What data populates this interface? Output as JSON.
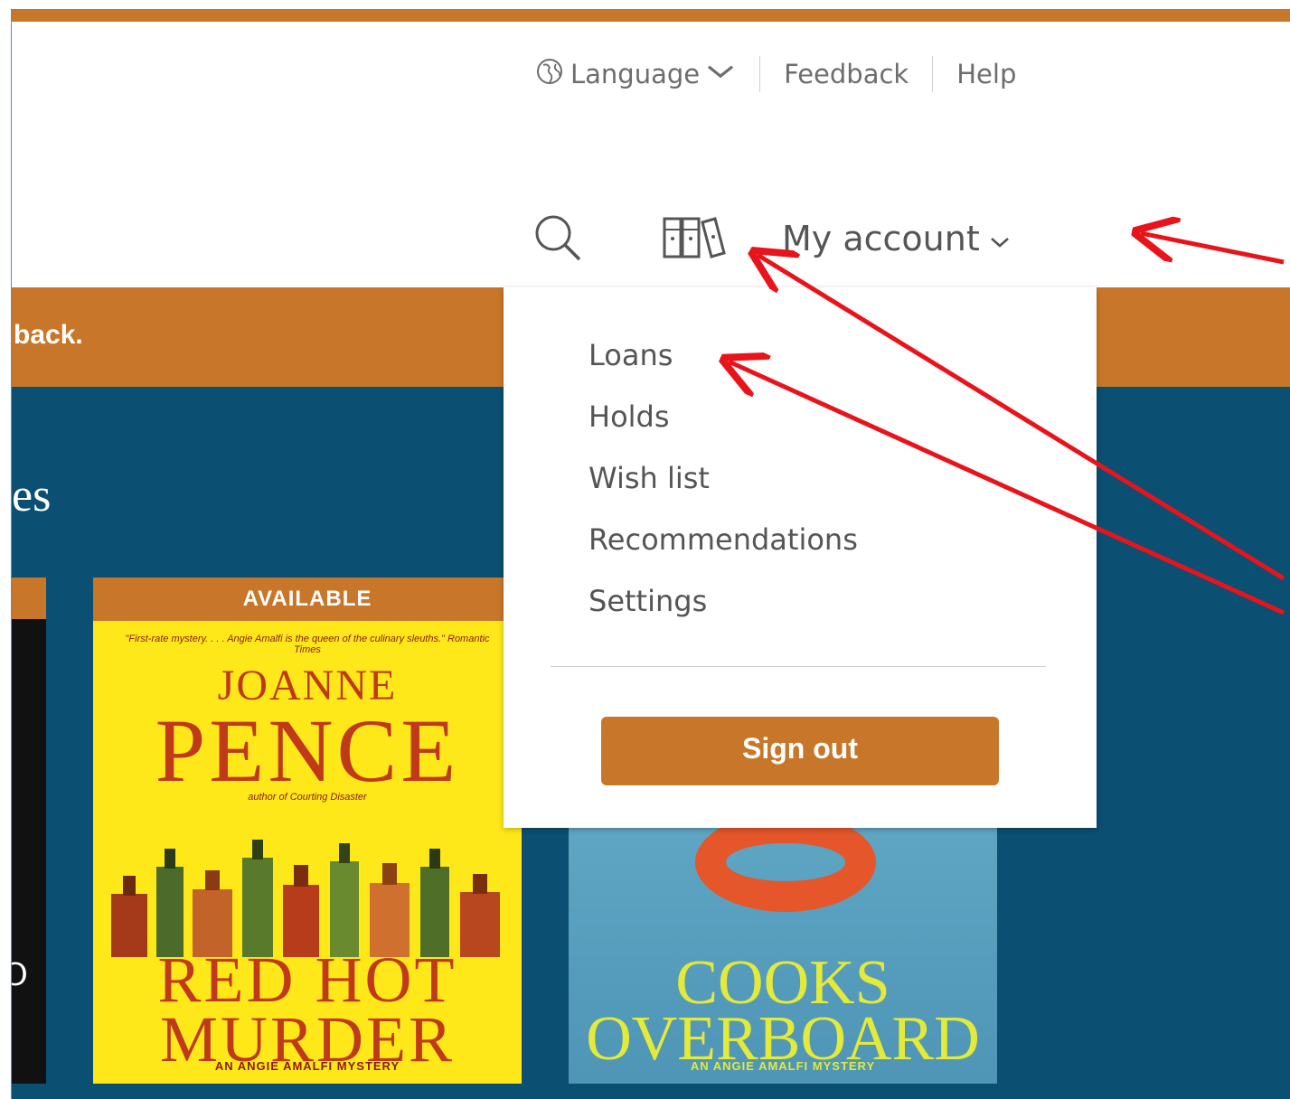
{
  "utility_nav": {
    "language_label": "Language",
    "feedback_label": "Feedback",
    "help_label": "Help"
  },
  "main_nav": {
    "account_label": "My account"
  },
  "welcome_banner": {
    "text": "back."
  },
  "section": {
    "title_partial": "es"
  },
  "account_menu": {
    "items": [
      "Loans",
      "Holds",
      "Wish list",
      "Recommendations",
      "Settings"
    ],
    "sign_out_label": "Sign out"
  },
  "books": [
    {
      "badge": "AVAILABLE",
      "quote": "\"First-rate mystery. . . . Angie Amalfi is the queen of the culinary sleuths.\" Romantic Times",
      "author_first": "JOANNE",
      "author_last": "PENCE",
      "byline": "author of Courting Disaster",
      "title_line1": "RED HOT",
      "title_line2": "MURDER",
      "series": "AN ANGIE AMALFI MYSTERY"
    },
    {
      "title_line1": "COOKS",
      "title_line2": "OVERBOARD",
      "series": "AN ANGIE AMALFI MYSTERY"
    }
  ],
  "colors": {
    "accent": "#c8772a",
    "page_background": "#0b4f72",
    "annotation_arrow": "#e8141c"
  }
}
